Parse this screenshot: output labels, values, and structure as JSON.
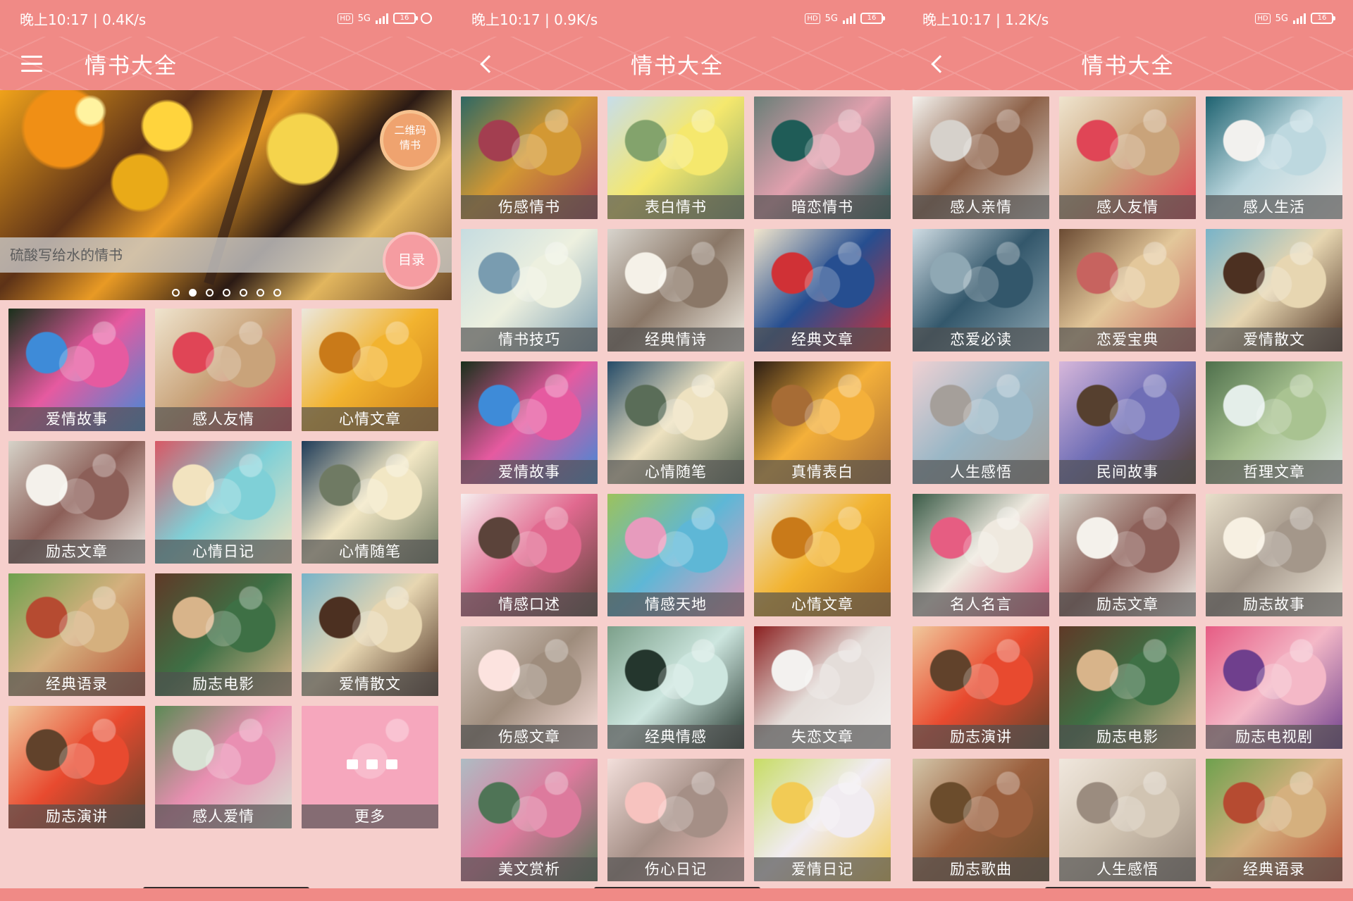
{
  "status": {
    "screen_1": "晚上10:17 | 0.4K/s",
    "screen_2": "晚上10:17 | 0.9K/s",
    "screen_3": "晚上10:17 | 1.2K/s",
    "hd": "HD",
    "network": "5G",
    "battery": "16"
  },
  "screens": [
    {
      "title": "情书大全"
    },
    {
      "title": "情书大全"
    },
    {
      "title": "情书大全"
    }
  ],
  "banner": {
    "badge_line_1": "二维码",
    "badge_line_2": "情书",
    "quote": "硫酸写给水的情书",
    "catalog_button": "目录",
    "active_dot_index": 1,
    "dot_count": 7
  },
  "grids": {
    "screen_1": [
      {
        "label": "爱情故事",
        "colors": [
          "#1a301b",
          "#e65aa0",
          "#3e8bd8"
        ]
      },
      {
        "label": "感人友情",
        "colors": [
          "#efe4ce",
          "#c9a37a",
          "#e04556"
        ]
      },
      {
        "label": "心情文章",
        "colors": [
          "#ebe7dc",
          "#f2b32f",
          "#c97a19"
        ]
      },
      {
        "label": "励志文章",
        "colors": [
          "#d6d2c8",
          "#8c5f58",
          "#f4f1eb"
        ]
      },
      {
        "label": "心情日记",
        "colors": [
          "#d85865",
          "#7fd0d7",
          "#f2e3bf"
        ]
      },
      {
        "label": "心情随笔",
        "colors": [
          "#1f3c59",
          "#f2e7c4",
          "#6f7a63"
        ]
      },
      {
        "label": "经典语录",
        "colors": [
          "#6ea14e",
          "#d5b07e",
          "#b64b31"
        ]
      },
      {
        "label": "励志电影",
        "colors": [
          "#5f3927",
          "#3e7045",
          "#d8b48a"
        ]
      },
      {
        "label": "爱情散文",
        "colors": [
          "#78b3c8",
          "#e7d6b1",
          "#4c3021"
        ]
      },
      {
        "label": "励志演讲",
        "colors": [
          "#f0c89c",
          "#e84a2f",
          "#61422b"
        ]
      },
      {
        "label": "感人爱情",
        "colors": [
          "#5c8a55",
          "#e98fb2",
          "#d7e1d3"
        ]
      },
      {
        "label": "更多",
        "colors": [
          "#f6a7bd",
          "#f6a7bd",
          "#f6a7bd"
        ]
      }
    ],
    "screen_2": [
      {
        "label": "伤感情书",
        "colors": [
          "#2e6863",
          "#d39833",
          "#a33e50"
        ]
      },
      {
        "label": "表白情书",
        "colors": [
          "#c7ddea",
          "#f5e86d",
          "#83a36c"
        ]
      },
      {
        "label": "暗恋情书",
        "colors": [
          "#6a7e77",
          "#e1a0ae",
          "#1f5c57"
        ]
      },
      {
        "label": "情书技巧",
        "colors": [
          "#c6dce0",
          "#edf0df",
          "#799cb0"
        ]
      },
      {
        "label": "经典情诗",
        "colors": [
          "#d8d4cd",
          "#8a7767",
          "#f5f1e8"
        ]
      },
      {
        "label": "经典文章",
        "colors": [
          "#f2e6cd",
          "#264e90",
          "#d03136"
        ]
      },
      {
        "label": "爱情故事",
        "colors": [
          "#1a301b",
          "#e65aa0",
          "#3e8bd8"
        ]
      },
      {
        "label": "心情随笔",
        "colors": [
          "#254b68",
          "#eee2c0",
          "#5a6d58"
        ]
      },
      {
        "label": "真情表白",
        "colors": [
          "#2c1d14",
          "#f4b03a",
          "#a76c35"
        ]
      },
      {
        "label": "情感口述",
        "colors": [
          "#f6eeee",
          "#e1698f",
          "#5b433a"
        ]
      },
      {
        "label": "情感天地",
        "colors": [
          "#9cc25d",
          "#5eb7d6",
          "#e79bbd"
        ]
      },
      {
        "label": "心情文章",
        "colors": [
          "#ebe7dc",
          "#f2b32f",
          "#c97a19"
        ]
      },
      {
        "label": "伤感文章",
        "colors": [
          "#d7cbc2",
          "#9e8c7c",
          "#fce3df"
        ]
      },
      {
        "label": "经典情感",
        "colors": [
          "#7ca08a",
          "#cde6df",
          "#24362d"
        ]
      },
      {
        "label": "失恋文章",
        "colors": [
          "#8b2020",
          "#e4ddd9",
          "#f3f1ef"
        ]
      },
      {
        "label": "美文赏析",
        "colors": [
          "#aebcc3",
          "#dd7a9d",
          "#4f7456"
        ]
      },
      {
        "label": "伤心日记",
        "colors": [
          "#f3dfdb",
          "#a58f86",
          "#f7c3bf"
        ]
      },
      {
        "label": "爱情日记",
        "colors": [
          "#c7dc65",
          "#f1ecf1",
          "#f2cb55"
        ]
      }
    ],
    "screen_3": [
      {
        "label": "感人亲情",
        "colors": [
          "#f4f2ee",
          "#8d6148",
          "#d6d1cb"
        ]
      },
      {
        "label": "感人友情",
        "colors": [
          "#efe4ce",
          "#c9a37a",
          "#e04556"
        ]
      },
      {
        "label": "感人生活",
        "colors": [
          "#1e6270",
          "#bdd8df",
          "#f2f1ee"
        ]
      },
      {
        "label": "恋爱必读",
        "colors": [
          "#cfdce3",
          "#33576b",
          "#8fa8b4"
        ]
      },
      {
        "label": "恋爱宝典",
        "colors": [
          "#6b4b33",
          "#e3c79a",
          "#c7635f"
        ]
      },
      {
        "label": "爱情散文",
        "colors": [
          "#78b3c8",
          "#e7d6b1",
          "#4c3021"
        ]
      },
      {
        "label": "人生感悟",
        "colors": [
          "#efd1d3",
          "#9ab7c6",
          "#a59f9a"
        ]
      },
      {
        "label": "民间故事",
        "colors": [
          "#d7b7da",
          "#6f6eb6",
          "#56402f"
        ]
      },
      {
        "label": "哲理文章",
        "colors": [
          "#4f704c",
          "#a9c391",
          "#e4eee9"
        ]
      },
      {
        "label": "名人名言",
        "colors": [
          "#3a5b47",
          "#efe9df",
          "#e65d82"
        ]
      },
      {
        "label": "励志文章",
        "colors": [
          "#d6d2c8",
          "#8c5f58",
          "#f4f1eb"
        ]
      },
      {
        "label": "励志故事",
        "colors": [
          "#e8dfca",
          "#a4978a",
          "#f7f0e2"
        ]
      },
      {
        "label": "励志演讲",
        "colors": [
          "#f0c89c",
          "#e84a2f",
          "#61422b"
        ]
      },
      {
        "label": "励志电影",
        "colors": [
          "#5f3927",
          "#3e7045",
          "#d8b48a"
        ]
      },
      {
        "label": "励志电视剧",
        "colors": [
          "#e65c84",
          "#f4b8c7",
          "#6f3f8d"
        ]
      },
      {
        "label": "励志歌曲",
        "colors": [
          "#d3c5a8",
          "#9a5e3c",
          "#6b4c2c"
        ]
      },
      {
        "label": "人生感悟",
        "colors": [
          "#f0e7dd",
          "#d1c4b2",
          "#9b8c7f"
        ]
      },
      {
        "label": "经典语录",
        "colors": [
          "#6ea14e",
          "#d5b07e",
          "#b64b31"
        ]
      }
    ]
  }
}
